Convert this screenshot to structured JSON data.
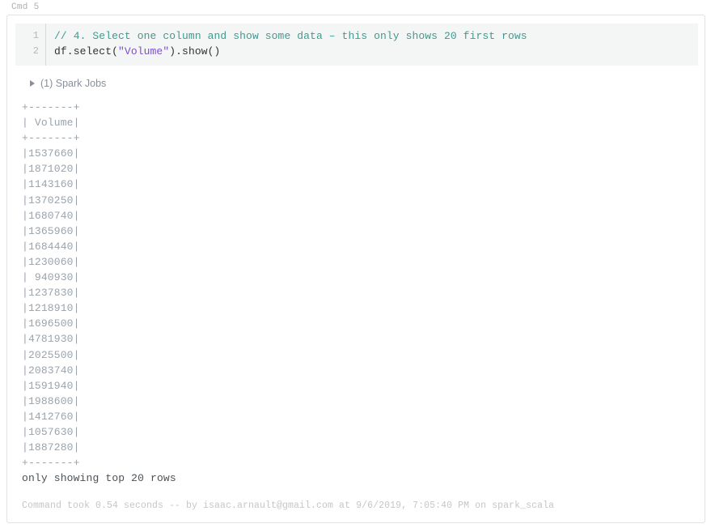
{
  "cell": {
    "label": "Cmd 5"
  },
  "code": {
    "lines": [
      {
        "number": "1",
        "tokens": [
          {
            "type": "comment",
            "text": "// 4. Select one column and show some data – this only shows 20 first rows"
          }
        ]
      },
      {
        "number": "2",
        "tokens": [
          {
            "type": "plain",
            "text": "df.select("
          },
          {
            "type": "string",
            "text": "\"Volume\""
          },
          {
            "type": "plain",
            "text": ").show()"
          }
        ]
      }
    ]
  },
  "spark_jobs": {
    "icon": "triangle-right-icon",
    "label": "(1) Spark Jobs"
  },
  "output": {
    "lines": [
      {
        "kind": "rule",
        "text": "+-------+"
      },
      {
        "kind": "rule",
        "text": "| Volume|"
      },
      {
        "kind": "rule",
        "text": "+-------+"
      },
      {
        "kind": "row",
        "text": "|1537660|"
      },
      {
        "kind": "row",
        "text": "|1871020|"
      },
      {
        "kind": "row",
        "text": "|1143160|"
      },
      {
        "kind": "row",
        "text": "|1370250|"
      },
      {
        "kind": "row",
        "text": "|1680740|"
      },
      {
        "kind": "row",
        "text": "|1365960|"
      },
      {
        "kind": "row",
        "text": "|1684440|"
      },
      {
        "kind": "row",
        "text": "|1230060|"
      },
      {
        "kind": "row",
        "text": "| 940930|"
      },
      {
        "kind": "row",
        "text": "|1237830|"
      },
      {
        "kind": "row",
        "text": "|1218910|"
      },
      {
        "kind": "row",
        "text": "|1696500|"
      },
      {
        "kind": "row",
        "text": "|4781930|"
      },
      {
        "kind": "row",
        "text": "|2025500|"
      },
      {
        "kind": "row",
        "text": "|2083740|"
      },
      {
        "kind": "row",
        "text": "|1591940|"
      },
      {
        "kind": "row",
        "text": "|1988600|"
      },
      {
        "kind": "row",
        "text": "|1412760|"
      },
      {
        "kind": "row",
        "text": "|1057630|"
      },
      {
        "kind": "row",
        "text": "|1887280|"
      },
      {
        "kind": "rule",
        "text": "+-------+"
      },
      {
        "kind": "note",
        "text": "only showing top 20 rows"
      }
    ],
    "column_header": "Volume",
    "values": [
      "1537660",
      "1871020",
      "1143160",
      "1370250",
      "1680740",
      "1365960",
      "1684440",
      "1230060",
      "940930",
      "1237830",
      "1218910",
      "1696500",
      "4781930",
      "2025500",
      "2083740",
      "1591940",
      "1988600",
      "1412760",
      "1057630",
      "1887280"
    ],
    "truncation_note": "only showing top 20 rows"
  },
  "footer": {
    "text": "Command took 0.54 seconds -- by isaac.arnault@gmail.com at 9/6/2019, 7:05:40 PM on spark_scala",
    "duration": "0.54 seconds",
    "user": "isaac.arnault@gmail.com",
    "timestamp": "9/6/2019, 7:05:40 PM",
    "cluster": "spark_scala"
  },
  "colors": {
    "comment": "#3f9b8f",
    "string": "#7b4fcf",
    "code": "#2f3337",
    "editor_bg": "#f4f5f5",
    "output_text": "#9aa3ab",
    "muted": "#c3c7cb"
  }
}
